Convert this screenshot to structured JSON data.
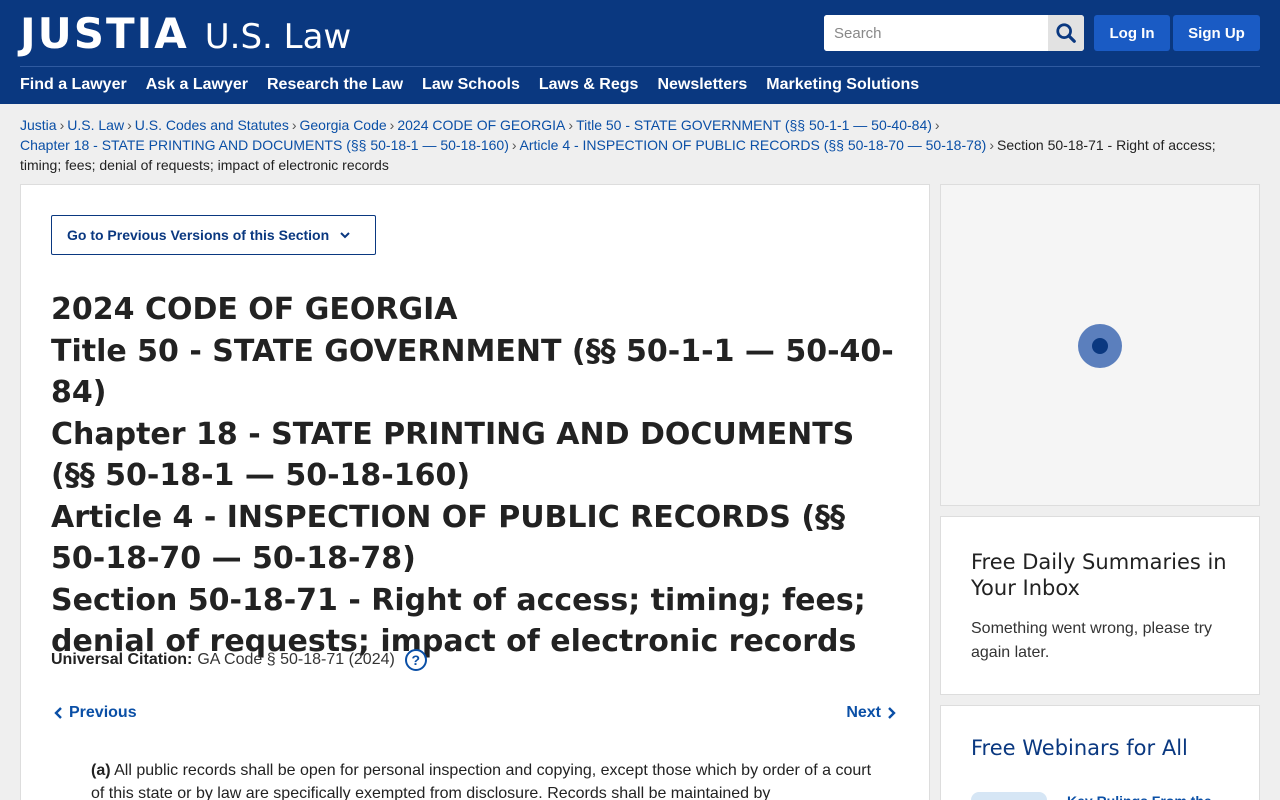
{
  "header": {
    "logo_main": "JUSTIA",
    "logo_sub": "U.S. Law",
    "search_placeholder": "Search",
    "login_label": "Log In",
    "signup_label": "Sign Up",
    "nav": [
      "Find a Lawyer",
      "Ask a Lawyer",
      "Research the Law",
      "Law Schools",
      "Laws & Regs",
      "Newsletters",
      "Marketing Solutions"
    ]
  },
  "breadcrumb": {
    "links": [
      "Justia",
      "U.S. Law",
      "U.S. Codes and Statutes",
      "Georgia Code",
      "2024 CODE OF GEORGIA",
      "Title 50 - STATE GOVERNMENT (§§ 50-1-1 — 50-40-84)",
      "Chapter 18 - STATE PRINTING AND DOCUMENTS (§§ 50-18-1 — 50-18-160)",
      "Article 4 - INSPECTION OF PUBLIC RECORDS (§§ 50-18-70 — 50-18-78)"
    ],
    "current": "Section 50-18-71 - Right of access; timing; fees; denial of requests; impact of electronic records",
    "separator": "›"
  },
  "main": {
    "versions_button": "Go to Previous Versions of this Section",
    "heading_lines": [
      "2024 CODE OF GEORGIA",
      "Title 50 - STATE GOVERNMENT (§§ 50-1-1 — 50-40-84)",
      "Chapter 18 - STATE PRINTING AND DOCUMENTS (§§ 50-18-1 — 50-18-160)",
      "Article 4 - INSPECTION OF PUBLIC RECORDS (§§ 50-18-70 — 50-18-78)",
      "Section 50-18-71 - Right of access; timing; fees; denial of requests; impact of electronic records"
    ],
    "citation_label": "Universal Citation:",
    "citation_value": "GA Code § 50-18-71 (2024)",
    "help_glyph": "?",
    "previous_label": "Previous",
    "next_label": "Next",
    "body_marker": "(a)",
    "body_text": "All public records shall be open for personal inspection and copying, except those which by order of a court of this state or by law are specifically exempted from disclosure. Records shall be maintained by"
  },
  "sidebar": {
    "summaries_title": "Free Daily Summaries in Your Inbox",
    "summaries_message": "Something went wrong, please try again later.",
    "webinars_title": "Free Webinars for All",
    "webinar_item_title": "Key Rulings From the"
  },
  "colors": {
    "brand_navy": "#0a3880",
    "button_blue": "#1a5bc4",
    "link_blue": "#0a4fa6",
    "page_bg": "#efefef"
  }
}
